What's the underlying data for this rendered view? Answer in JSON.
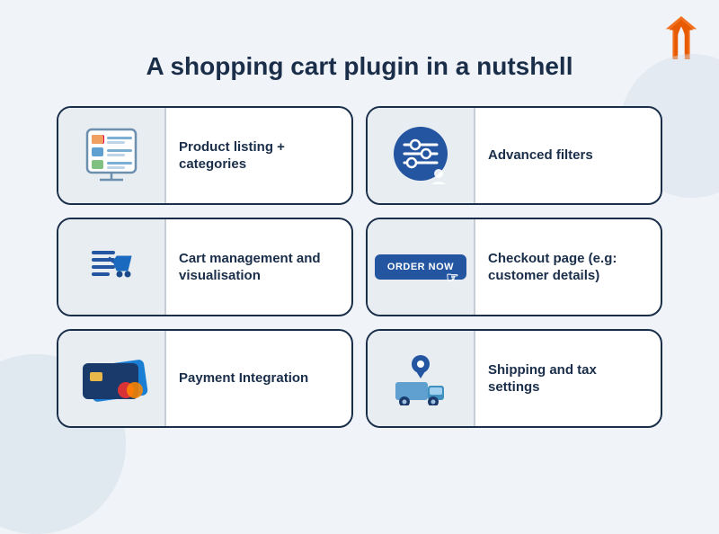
{
  "page": {
    "title": "A shopping cart plugin in a nutshell",
    "background": "#f0f4f8"
  },
  "logo": {
    "alt": "W logo"
  },
  "cards": [
    {
      "id": "product-listing",
      "label": "Product listing + categories",
      "icon": "product-listing-icon"
    },
    {
      "id": "advanced-filters",
      "label": "Advanced filters",
      "icon": "advanced-filters-icon"
    },
    {
      "id": "cart-management",
      "label": "Cart management and visualisation",
      "icon": "cart-management-icon"
    },
    {
      "id": "checkout-page",
      "label": "Checkout page (e.g: customer details)",
      "icon": "checkout-icon"
    },
    {
      "id": "payment-integration",
      "label": "Payment Integration",
      "icon": "payment-icon"
    },
    {
      "id": "shipping-tax",
      "label": "Shipping and tax settings",
      "icon": "shipping-icon"
    }
  ]
}
